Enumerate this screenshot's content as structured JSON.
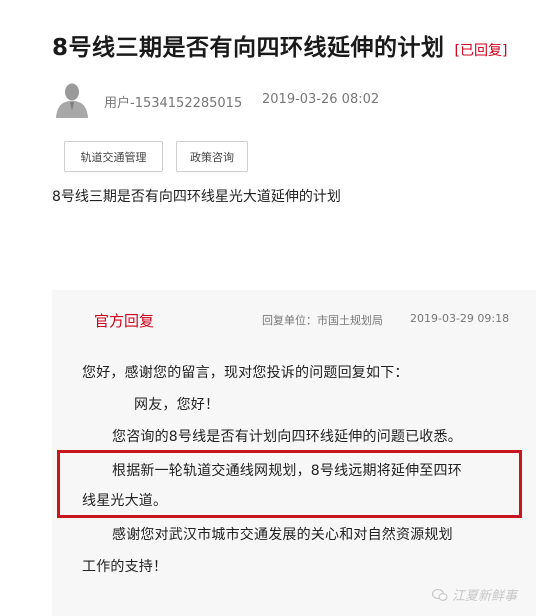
{
  "post": {
    "title": "8号线三期是否有向四环线延伸的计划",
    "status": "[已回复]",
    "user": "用户-1534152285015",
    "time": "2019-03-26 08:02",
    "tags": [
      "轨道交通管理",
      "政策咨询"
    ],
    "content": "8号线三期是否有向四环线星光大道延伸的计划"
  },
  "reply": {
    "label": "官方回复",
    "unit": "回复单位：市国土规划局",
    "time": "2019-03-29 09:18",
    "lines": [
      "您好，感谢您的留言，现对您投诉的问题回复如下：",
      "网友，您好！",
      "您咨询的8号线是否有计划向四环线延伸的问题已收悉。",
      "根据新一轮轨道交通线网规划，8号线远期将延伸至四环",
      "线星光大道。",
      "感谢您对武汉市城市交通发展的关心和对自然资源规划",
      "工作的支持！"
    ]
  },
  "watermark": "江夏新鲜事",
  "colors": {
    "accent": "#d0021b",
    "highlight_border": "#c8161d",
    "reply_bg": "#f7f7f7"
  },
  "icons": {
    "avatar": "user-silhouette-icon",
    "watermark": "wechat-logo-icon"
  }
}
